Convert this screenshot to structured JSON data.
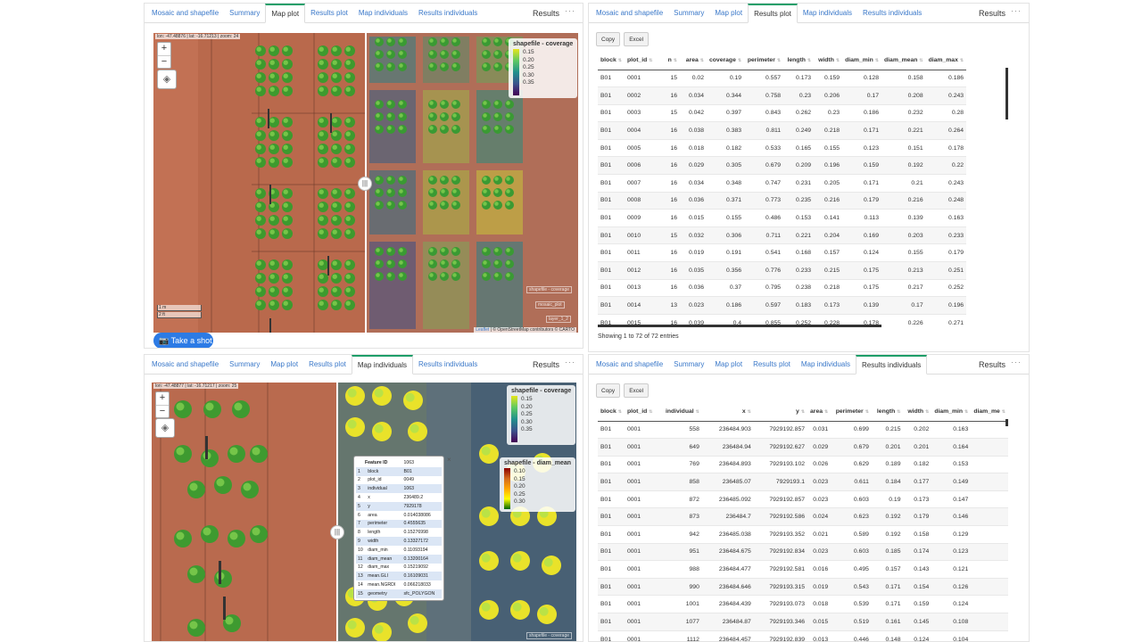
{
  "tabs_tl": [
    "Mosaic and shapefile",
    "Summary",
    "Map plot",
    "Results plot",
    "Map individuals",
    "Results individuals"
  ],
  "tabs_tl_active": 2,
  "tabs_tr": [
    "Mosaic and shapefile",
    "Summary",
    "Map plot",
    "Results plot",
    "Map individuals",
    "Results individuals"
  ],
  "tabs_tr_active": 3,
  "tabs_bl": [
    "Mosaic and shapefile",
    "Summary",
    "Map plot",
    "Results plot",
    "Map individuals",
    "Results individuals"
  ],
  "tabs_bl_active": 4,
  "tabs_br": [
    "Mosaic and shapefile",
    "Summary",
    "Map plot",
    "Results plot",
    "Map individuals",
    "Results individuals"
  ],
  "tabs_br_active": 5,
  "results_title": "Results",
  "menu_icon": "more-horizontal-icon",
  "map_tl": {
    "coord": "lon: -47.48876 | lat: -16.71213 | zoom: 24",
    "legend_title": "shapefile - coverage",
    "legend_ticks": [
      "0.15",
      "0.20",
      "0.25",
      "0.30",
      "0.35"
    ],
    "scale_labels": [
      "1 m",
      "2 ft"
    ],
    "layer_labels": [
      "shapefile - coverage",
      "mosaic_plot",
      "layer_1_2"
    ],
    "attribution_link": "Leaflet",
    "attribution_text": "| © OpenStreetMap contributors © CARTO"
  },
  "take_shot_label": "Take a shot",
  "map_bl": {
    "coord": "lon: -47.48877 | lat: -16.71217 | zoom: 25",
    "legend1_title": "shapefile - coverage",
    "legend1_ticks": [
      "0.15",
      "0.20",
      "0.25",
      "0.30",
      "0.35"
    ],
    "legend2_title": "shapefile - diam_mean",
    "legend2_ticks": [
      "0.10",
      "0.15",
      "0.20",
      "0.25",
      "0.30"
    ],
    "layer_labels": [
      "shapefile - coverage"
    ]
  },
  "popup": {
    "header": [
      "Feature ID",
      "1063"
    ],
    "rows": [
      [
        "1",
        "block",
        "B01"
      ],
      [
        "2",
        "plot_id",
        "0049"
      ],
      [
        "3",
        "individual",
        "1063"
      ],
      [
        "4",
        "x",
        "236489.2"
      ],
      [
        "5",
        "y",
        "7929178"
      ],
      [
        "6",
        "area",
        "0.014038086"
      ],
      [
        "7",
        "perimeter",
        "0.4555635"
      ],
      [
        "8",
        "length",
        "0.15276998"
      ],
      [
        "9",
        "width",
        "0.13327172"
      ],
      [
        "10",
        "diam_min",
        "0.11093194"
      ],
      [
        "11",
        "diam_mean",
        "0.13200164"
      ],
      [
        "12",
        "diam_max",
        "0.15219092"
      ],
      [
        "13",
        "mean.GLI",
        "0.16109031"
      ],
      [
        "14",
        "mean.NGRDI",
        "0.066218033"
      ],
      [
        "15",
        "geometry",
        "sfc_POLYGON"
      ]
    ],
    "close": "×"
  },
  "btn_copy": "Copy",
  "btn_excel": "Excel",
  "plot_table": {
    "headers": [
      "block",
      "plot_id",
      "n",
      "area",
      "coverage",
      "perimeter",
      "length",
      "width",
      "diam_min",
      "diam_mean",
      "diam_max"
    ],
    "rows": [
      [
        "B01",
        "0001",
        "15",
        "0.02",
        "0.19",
        "0.557",
        "0.173",
        "0.159",
        "0.128",
        "0.158",
        "0.186"
      ],
      [
        "B01",
        "0002",
        "16",
        "0.034",
        "0.344",
        "0.758",
        "0.23",
        "0.206",
        "0.17",
        "0.208",
        "0.243"
      ],
      [
        "B01",
        "0003",
        "15",
        "0.042",
        "0.397",
        "0.843",
        "0.262",
        "0.23",
        "0.186",
        "0.232",
        "0.28"
      ],
      [
        "B01",
        "0004",
        "16",
        "0.038",
        "0.383",
        "0.811",
        "0.249",
        "0.218",
        "0.171",
        "0.221",
        "0.264"
      ],
      [
        "B01",
        "0005",
        "16",
        "0.018",
        "0.182",
        "0.533",
        "0.165",
        "0.155",
        "0.123",
        "0.151",
        "0.178"
      ],
      [
        "B01",
        "0006",
        "16",
        "0.029",
        "0.305",
        "0.679",
        "0.209",
        "0.196",
        "0.159",
        "0.192",
        "0.22"
      ],
      [
        "B01",
        "0007",
        "16",
        "0.034",
        "0.348",
        "0.747",
        "0.231",
        "0.205",
        "0.171",
        "0.21",
        "0.243"
      ],
      [
        "B01",
        "0008",
        "16",
        "0.036",
        "0.371",
        "0.773",
        "0.235",
        "0.216",
        "0.179",
        "0.216",
        "0.248"
      ],
      [
        "B01",
        "0009",
        "16",
        "0.015",
        "0.155",
        "0.486",
        "0.153",
        "0.141",
        "0.113",
        "0.139",
        "0.163"
      ],
      [
        "B01",
        "0010",
        "15",
        "0.032",
        "0.306",
        "0.711",
        "0.221",
        "0.204",
        "0.169",
        "0.203",
        "0.233"
      ],
      [
        "B01",
        "0011",
        "16",
        "0.019",
        "0.191",
        "0.541",
        "0.168",
        "0.157",
        "0.124",
        "0.155",
        "0.179"
      ],
      [
        "B01",
        "0012",
        "16",
        "0.035",
        "0.356",
        "0.776",
        "0.233",
        "0.215",
        "0.175",
        "0.213",
        "0.251"
      ],
      [
        "B01",
        "0013",
        "16",
        "0.036",
        "0.37",
        "0.795",
        "0.238",
        "0.218",
        "0.175",
        "0.217",
        "0.252"
      ],
      [
        "B01",
        "0014",
        "13",
        "0.023",
        "0.186",
        "0.597",
        "0.183",
        "0.173",
        "0.139",
        "0.17",
        "0.196"
      ],
      [
        "B01",
        "0015",
        "16",
        "0.039",
        "0.4",
        "0.855",
        "0.252",
        "0.228",
        "0.178",
        "0.226",
        "0.271"
      ]
    ],
    "info": "Showing 1 to 72 of 72 entries"
  },
  "ind_table": {
    "headers": [
      "block",
      "plot_id",
      "individual",
      "x",
      "y",
      "area",
      "perimeter",
      "length",
      "width",
      "diam_min",
      "diam_me"
    ],
    "rows": [
      [
        "B01",
        "0001",
        "558",
        "236484.903",
        "7929192.857",
        "0.031",
        "0.699",
        "0.215",
        "0.202",
        "0.163",
        ""
      ],
      [
        "B01",
        "0001",
        "649",
        "236484.94",
        "7929192.627",
        "0.029",
        "0.679",
        "0.201",
        "0.201",
        "0.164",
        ""
      ],
      [
        "B01",
        "0001",
        "769",
        "236484.893",
        "7929193.102",
        "0.026",
        "0.629",
        "0.189",
        "0.182",
        "0.153",
        ""
      ],
      [
        "B01",
        "0001",
        "858",
        "236485.07",
        "7929193.1",
        "0.023",
        "0.611",
        "0.184",
        "0.177",
        "0.149",
        ""
      ],
      [
        "B01",
        "0001",
        "872",
        "236485.092",
        "7929192.857",
        "0.023",
        "0.603",
        "0.19",
        "0.173",
        "0.147",
        ""
      ],
      [
        "B01",
        "0001",
        "873",
        "236484.7",
        "7929192.586",
        "0.024",
        "0.623",
        "0.192",
        "0.179",
        "0.146",
        ""
      ],
      [
        "B01",
        "0001",
        "942",
        "236485.038",
        "7929193.352",
        "0.021",
        "0.589",
        "0.192",
        "0.158",
        "0.129",
        ""
      ],
      [
        "B01",
        "0001",
        "951",
        "236484.675",
        "7929192.834",
        "0.023",
        "0.603",
        "0.185",
        "0.174",
        "0.123",
        ""
      ],
      [
        "B01",
        "0001",
        "988",
        "236484.477",
        "7929192.581",
        "0.016",
        "0.495",
        "0.157",
        "0.143",
        "0.121",
        ""
      ],
      [
        "B01",
        "0001",
        "990",
        "236484.646",
        "7929193.315",
        "0.019",
        "0.543",
        "0.171",
        "0.154",
        "0.126",
        ""
      ],
      [
        "B01",
        "0001",
        "1001",
        "236484.439",
        "7929193.073",
        "0.018",
        "0.539",
        "0.171",
        "0.159",
        "0.124",
        ""
      ],
      [
        "B01",
        "0001",
        "1077",
        "236484.87",
        "7929193.346",
        "0.015",
        "0.519",
        "0.161",
        "0.145",
        "0.108",
        ""
      ],
      [
        "B01",
        "0001",
        "1112",
        "236484.457",
        "7929192.839",
        "0.013",
        "0.446",
        "0.148",
        "0.124",
        "0.104",
        ""
      ]
    ]
  }
}
